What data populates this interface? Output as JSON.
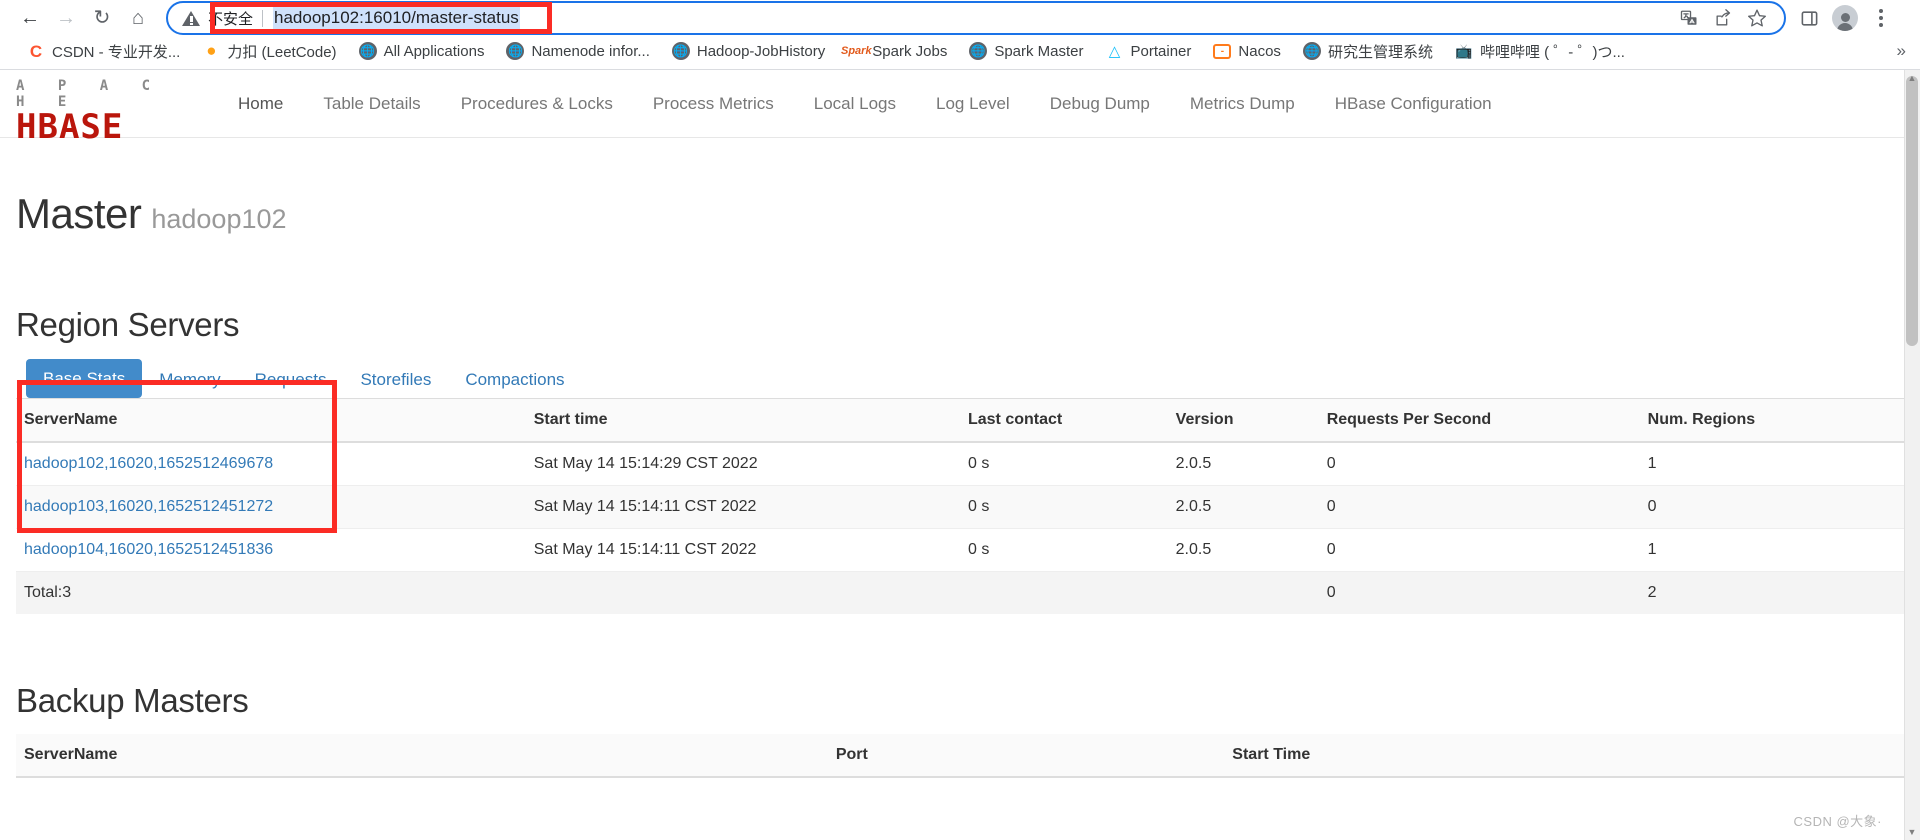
{
  "browser": {
    "nav": {
      "back_icon": "arrow-left-icon",
      "forward_icon": "arrow-right-icon",
      "reload_icon": "reload-icon",
      "home_icon": "home-icon"
    },
    "omnibox": {
      "security_icon": "not-secure-warning-icon",
      "security_label": "不安全",
      "url": "hadoop102:16010/master-status",
      "translate_icon": "translate-icon",
      "share_icon": "share-icon",
      "bookmark_icon": "star-icon"
    },
    "toolbar_right": {
      "sidepanel_icon": "side-panel-icon",
      "profile_icon": "profile-avatar-icon",
      "menu_icon": "three-dot-menu-icon"
    },
    "bookmarks": [
      {
        "label": "CSDN - 专业开发...",
        "icon": "csdn-icon"
      },
      {
        "label": "力扣 (LeetCode)",
        "icon": "leetcode-icon"
      },
      {
        "label": "All Applications",
        "icon": "globe-icon"
      },
      {
        "label": "Namenode infor...",
        "icon": "globe-icon"
      },
      {
        "label": "Hadoop-JobHistory",
        "icon": "globe-icon"
      },
      {
        "label": "Spark Jobs",
        "icon": "spark-icon"
      },
      {
        "label": "Spark Master",
        "icon": "globe-icon"
      },
      {
        "label": "Portainer",
        "icon": "portainer-icon"
      },
      {
        "label": "Nacos",
        "icon": "nacos-icon"
      },
      {
        "label": "研究生管理系统",
        "icon": "globe-icon"
      },
      {
        "label": "哔哩哔哩 ( ゜- ゜)つ...",
        "icon": "bilibili-icon"
      }
    ],
    "bookmarks_overflow": "»"
  },
  "hbase": {
    "logo": {
      "top": "A P A C H E",
      "bottom": "HBASE"
    },
    "nav": [
      {
        "label": "Home",
        "active": true
      },
      {
        "label": "Table Details",
        "active": false
      },
      {
        "label": "Procedures & Locks",
        "active": false
      },
      {
        "label": "Process Metrics",
        "active": false
      },
      {
        "label": "Local Logs",
        "active": false
      },
      {
        "label": "Log Level",
        "active": false
      },
      {
        "label": "Debug Dump",
        "active": false
      },
      {
        "label": "Metrics Dump",
        "active": false
      },
      {
        "label": "HBase Configuration",
        "active": false
      }
    ],
    "page_title": "Master",
    "page_subtitle": "hadoop102",
    "region_servers": {
      "heading": "Region Servers",
      "tabs": [
        {
          "label": "Base Stats",
          "active": true
        },
        {
          "label": "Memory",
          "active": false
        },
        {
          "label": "Requests",
          "active": false
        },
        {
          "label": "Storefiles",
          "active": false
        },
        {
          "label": "Compactions",
          "active": false
        }
      ],
      "columns": [
        "ServerName",
        "Start time",
        "Last contact",
        "Version",
        "Requests Per Second",
        "Num. Regions"
      ],
      "rows": [
        {
          "server": "hadoop102,16020,1652512469678",
          "start_time": "Sat May 14 15:14:29 CST 2022",
          "last_contact": "0 s",
          "version": "2.0.5",
          "rps": "0",
          "regions": "1"
        },
        {
          "server": "hadoop103,16020,1652512451272",
          "start_time": "Sat May 14 15:14:11 CST 2022",
          "last_contact": "0 s",
          "version": "2.0.5",
          "rps": "0",
          "regions": "0"
        },
        {
          "server": "hadoop104,16020,1652512451836",
          "start_time": "Sat May 14 15:14:11 CST 2022",
          "last_contact": "0 s",
          "version": "2.0.5",
          "rps": "0",
          "regions": "1"
        }
      ],
      "total": {
        "label": "Total:3",
        "start_time": "",
        "last_contact": "",
        "version": "",
        "rps": "0",
        "regions": "2"
      }
    },
    "backup_masters": {
      "heading": "Backup Masters",
      "columns": [
        "ServerName",
        "Port",
        "Start Time"
      ]
    }
  },
  "watermark": "CSDN @大象·",
  "colors": {
    "accent_blue": "#428bca",
    "link_blue": "#337ab7",
    "hbase_red": "#ba160c",
    "annotation_red": "#fb2c25",
    "omnibox_focus": "#1a73e8"
  }
}
